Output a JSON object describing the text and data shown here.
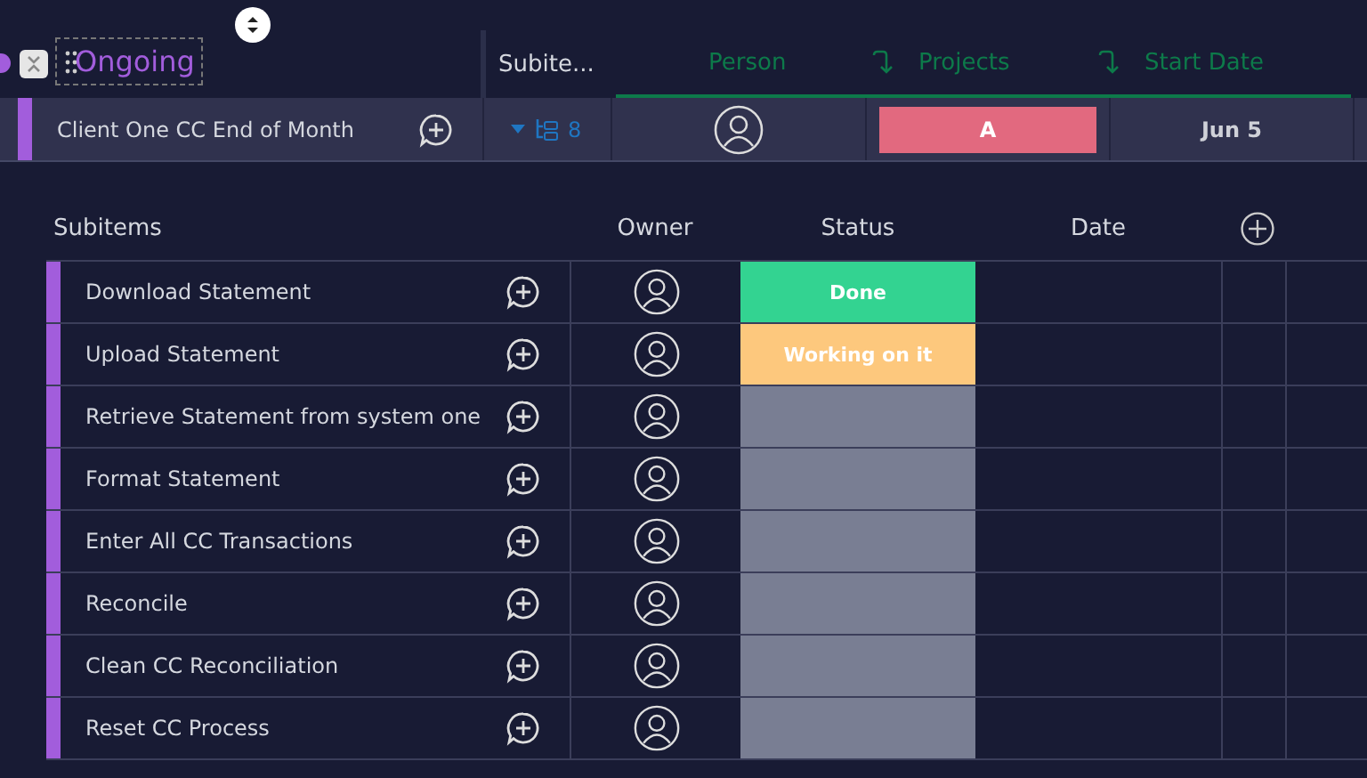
{
  "group": {
    "title": "Ongoing",
    "color": "#a25ddc"
  },
  "columns": [
    {
      "label": "Subite...",
      "kind": "plain"
    },
    {
      "label": "Person",
      "kind": "linked"
    },
    {
      "label": "Projects",
      "kind": "linked"
    },
    {
      "label": "Start Date",
      "kind": "linked"
    }
  ],
  "item": {
    "name": "Client One CC End of Month",
    "subitem_count": "8",
    "projects": {
      "label": "A",
      "color": "#e2697f"
    },
    "start_date": "Jun 5"
  },
  "subitems": {
    "columns": [
      "Subitems",
      "Owner",
      "Status",
      "Date"
    ],
    "rows": [
      {
        "name": "Download Statement",
        "status": {
          "label": "Done",
          "color": "#33d391"
        }
      },
      {
        "name": "Upload Statement",
        "status": {
          "label": "Working on it",
          "color": "#fdc87d"
        }
      },
      {
        "name": "Retrieve Statement from system one",
        "status": {
          "color": "#797e93"
        }
      },
      {
        "name": "Format Statement",
        "status": {
          "color": "#797e93"
        }
      },
      {
        "name": "Enter All CC Transactions",
        "status": {
          "color": "#797e93"
        }
      },
      {
        "name": "Reconcile",
        "status": {
          "color": "#797e93"
        }
      },
      {
        "name": "Clean CC Reconciliation",
        "status": {
          "color": "#797e93"
        }
      },
      {
        "name": "Reset CC Process",
        "status": {
          "color": "#797e93"
        }
      }
    ]
  }
}
